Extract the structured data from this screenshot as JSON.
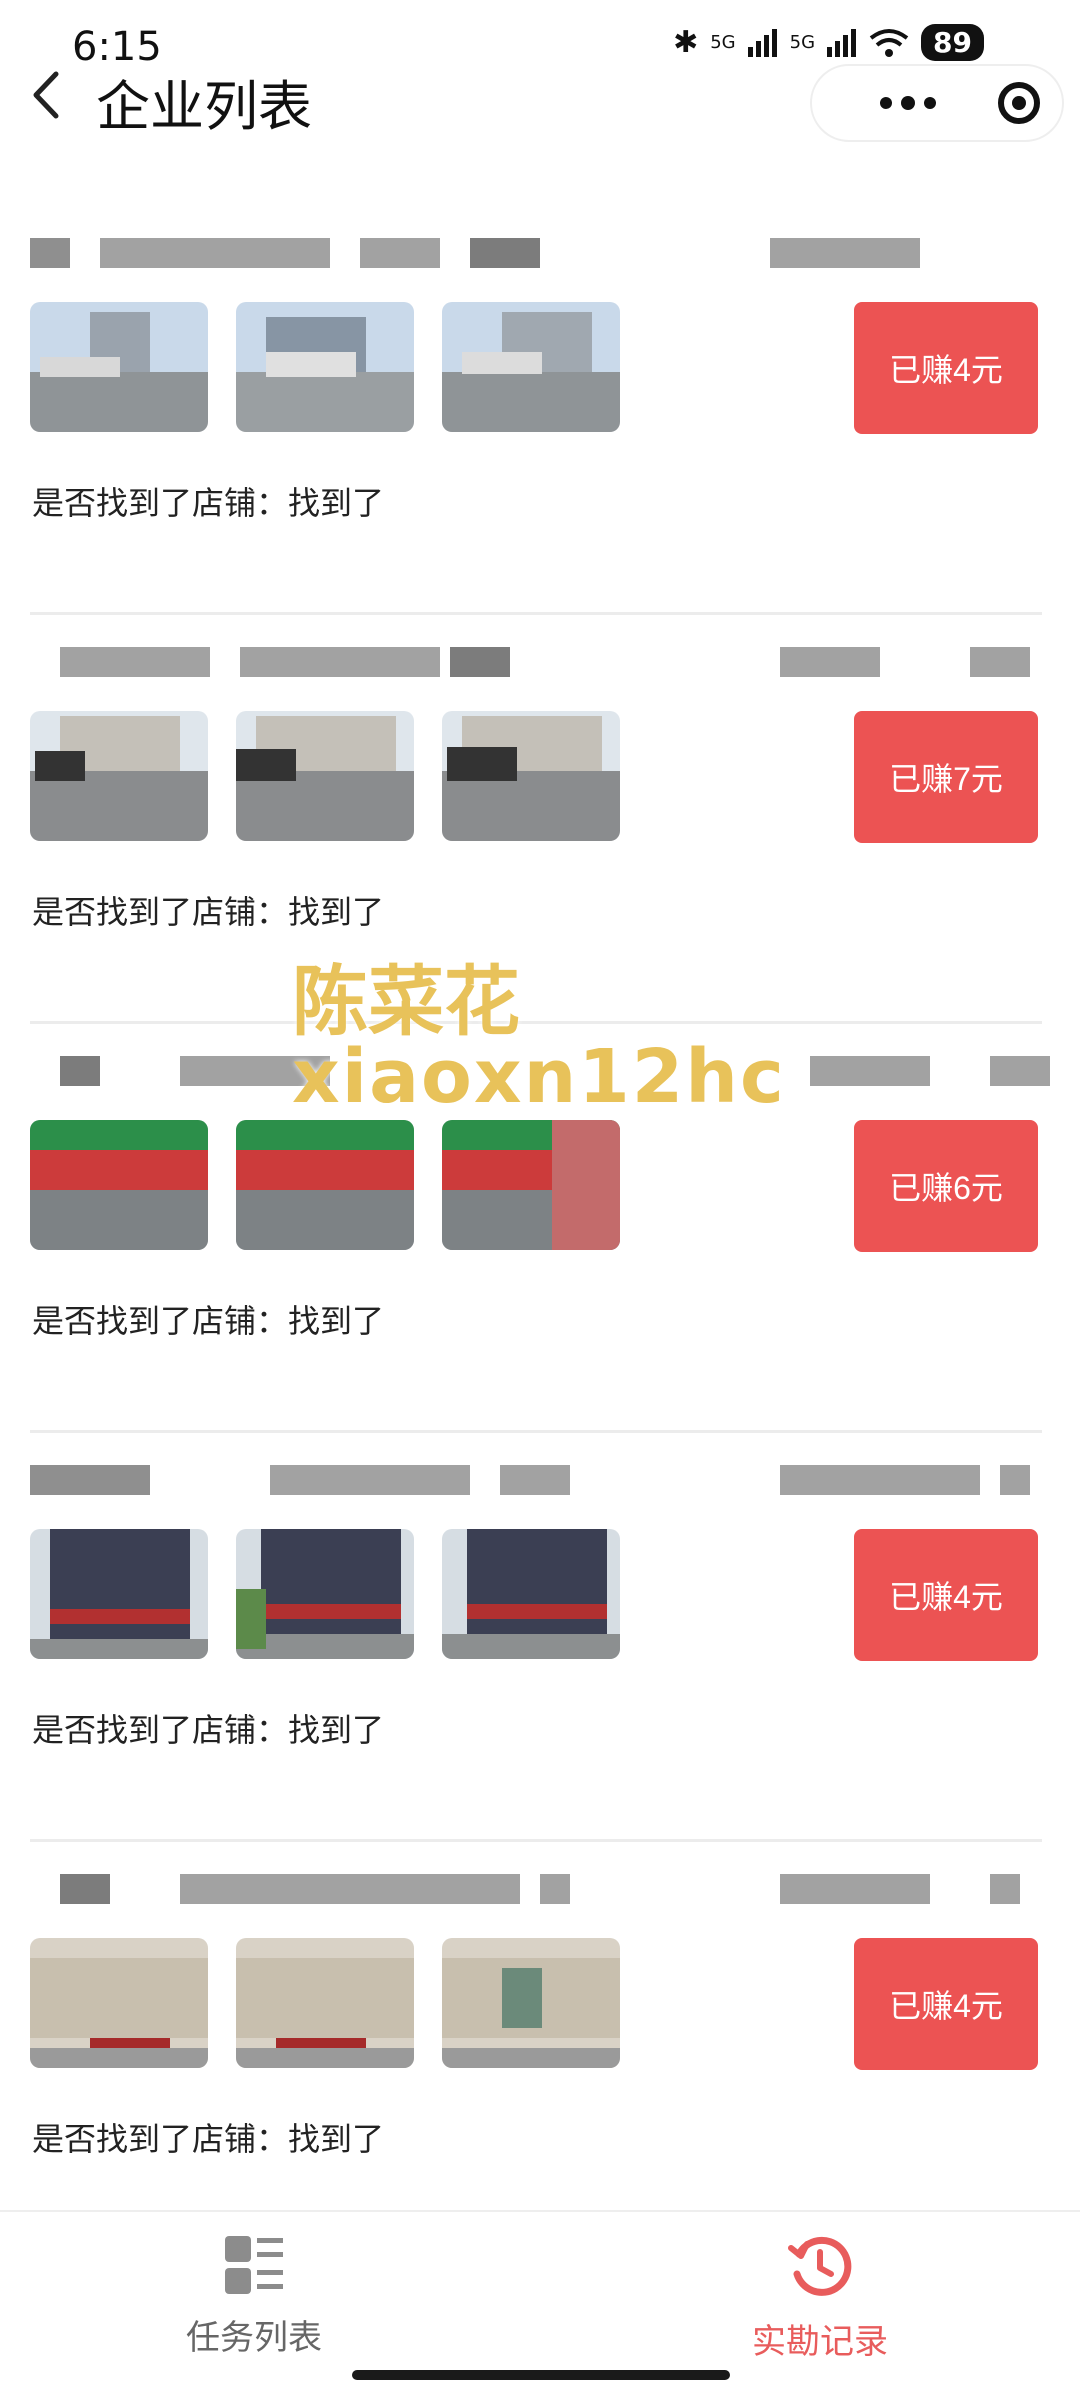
{
  "status_bar": {
    "time": "6:15",
    "network1": "5G",
    "network2": "5G",
    "battery": "89"
  },
  "nav": {
    "title": "企业列表"
  },
  "tasks": [
    {
      "earned_label": "已赚4元",
      "found_label": "是否找到了店铺：找到了"
    },
    {
      "earned_label": "已赚7元",
      "found_label": "是否找到了店铺：找到了"
    },
    {
      "earned_label": "已赚6元",
      "found_label": "是否找到了店铺：找到了"
    },
    {
      "earned_label": "已赚4元",
      "found_label": "是否找到了店铺：找到了"
    },
    {
      "earned_label": "已赚4元",
      "found_label": "是否找到了店铺：找到了"
    }
  ],
  "watermark": {
    "name": "陈菜花",
    "id": "xiaoxn12hc",
    "color": "#e8c25a"
  },
  "tab_bar": {
    "left_label": "任务列表",
    "right_label": "实勘记录",
    "active_color": "#e85c5c",
    "left_icon": "list-grid-icon",
    "right_icon": "history-clock-icon"
  },
  "colors": {
    "earn_button": "#ec5353"
  }
}
